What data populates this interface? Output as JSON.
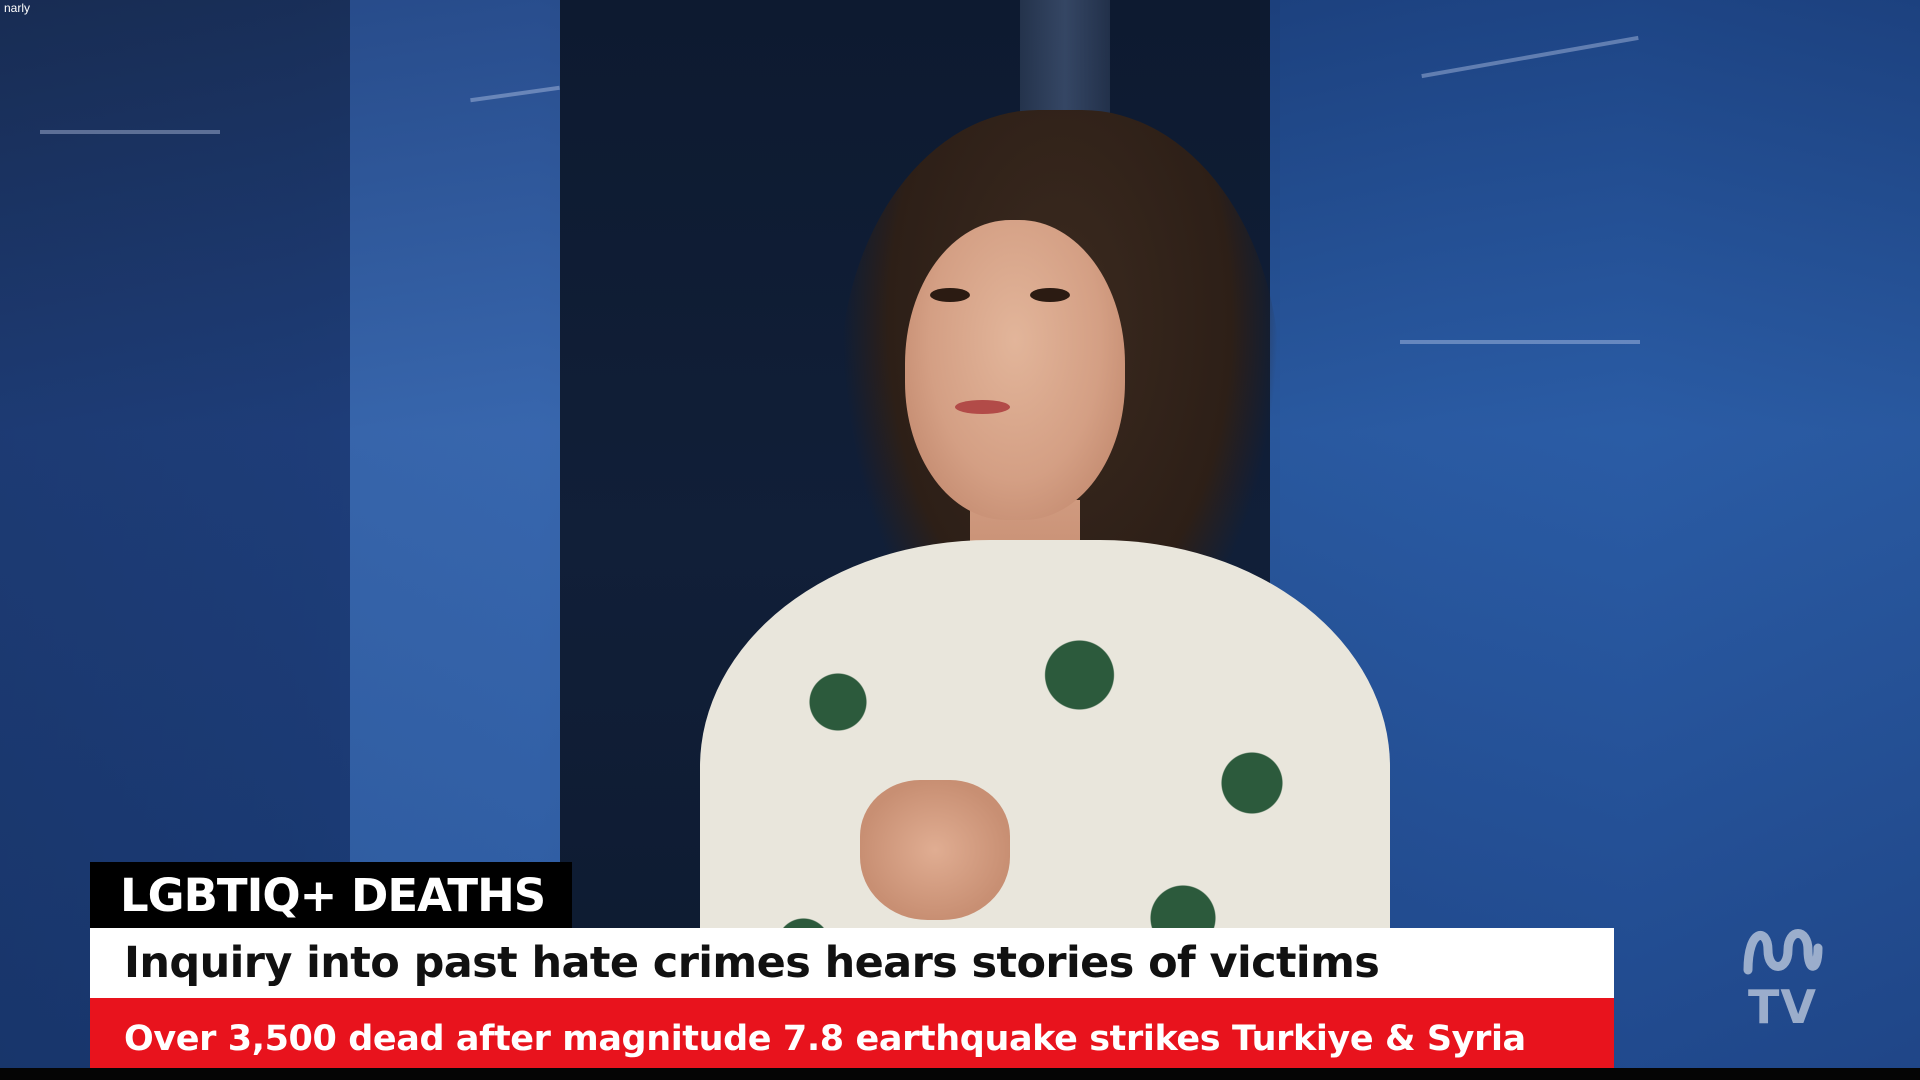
{
  "corner_label": "narly",
  "lower_third": {
    "topic": "LGBTIQ+ DEATHS",
    "headline": "Inquiry into past hate crimes hears stories of victims",
    "ticker": "Over 3,500 dead after magnitude 7.8 earthquake strikes Turkiye & Syria"
  },
  "logo": {
    "icon": "abc-lissajous-icon",
    "text": "TV"
  },
  "colors": {
    "ticker_red": "#e8131d",
    "topic_black": "#000000",
    "headline_white": "#ffffff",
    "studio_blue": "#1b4a8d"
  }
}
